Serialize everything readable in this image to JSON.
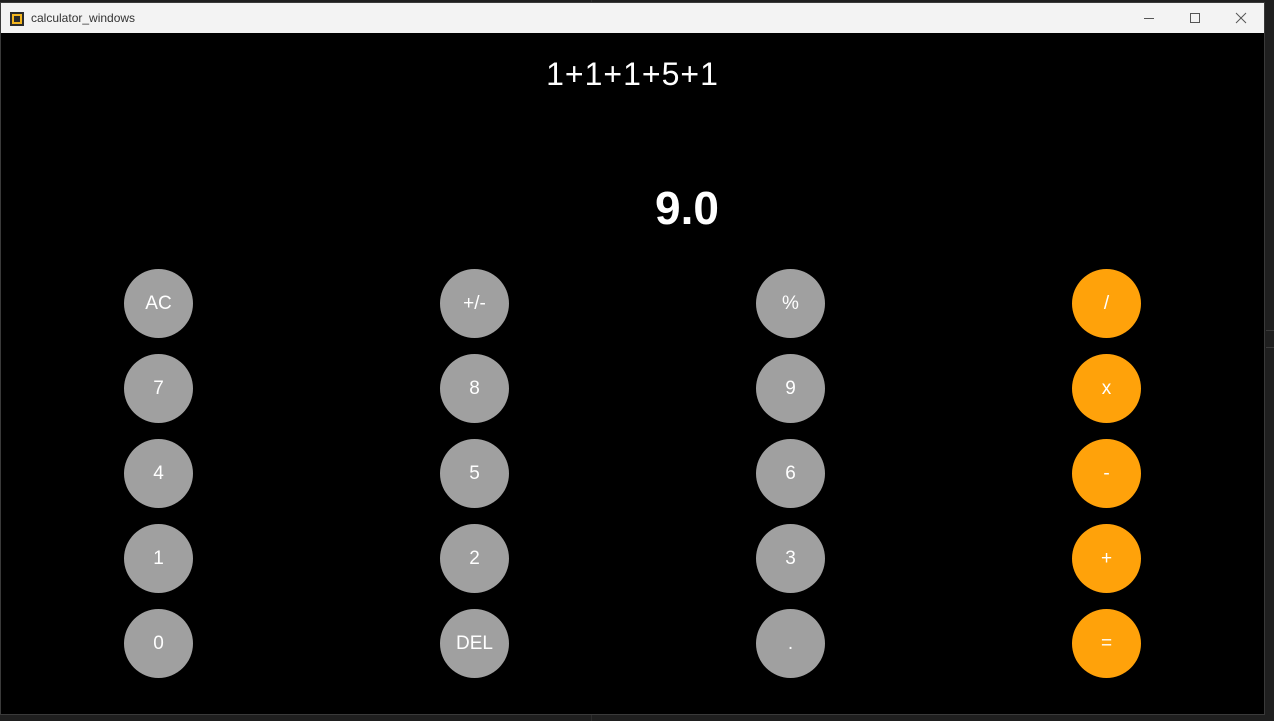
{
  "window": {
    "title": "calculator_windows",
    "controls": {
      "minimize_icon": "minimize-icon",
      "maximize_icon": "maximize-icon",
      "close_icon": "close-icon"
    }
  },
  "display": {
    "expression": "1+1+1+5+1",
    "result": "9.0"
  },
  "keys": {
    "ac": "AC",
    "plus_minus": "+/-",
    "percent": "%",
    "divide": "/",
    "seven": "7",
    "eight": "8",
    "nine": "9",
    "multiply": "x",
    "four": "4",
    "five": "5",
    "six": "6",
    "minus": "-",
    "one": "1",
    "two": "2",
    "three": "3",
    "plus": "+",
    "zero": "0",
    "del": "DEL",
    "dot": ".",
    "equals": "="
  },
  "colors": {
    "background": "#000000",
    "number_key": "#a0a0a0",
    "operator_key": "#ffa20a",
    "key_text": "#ffffff"
  }
}
